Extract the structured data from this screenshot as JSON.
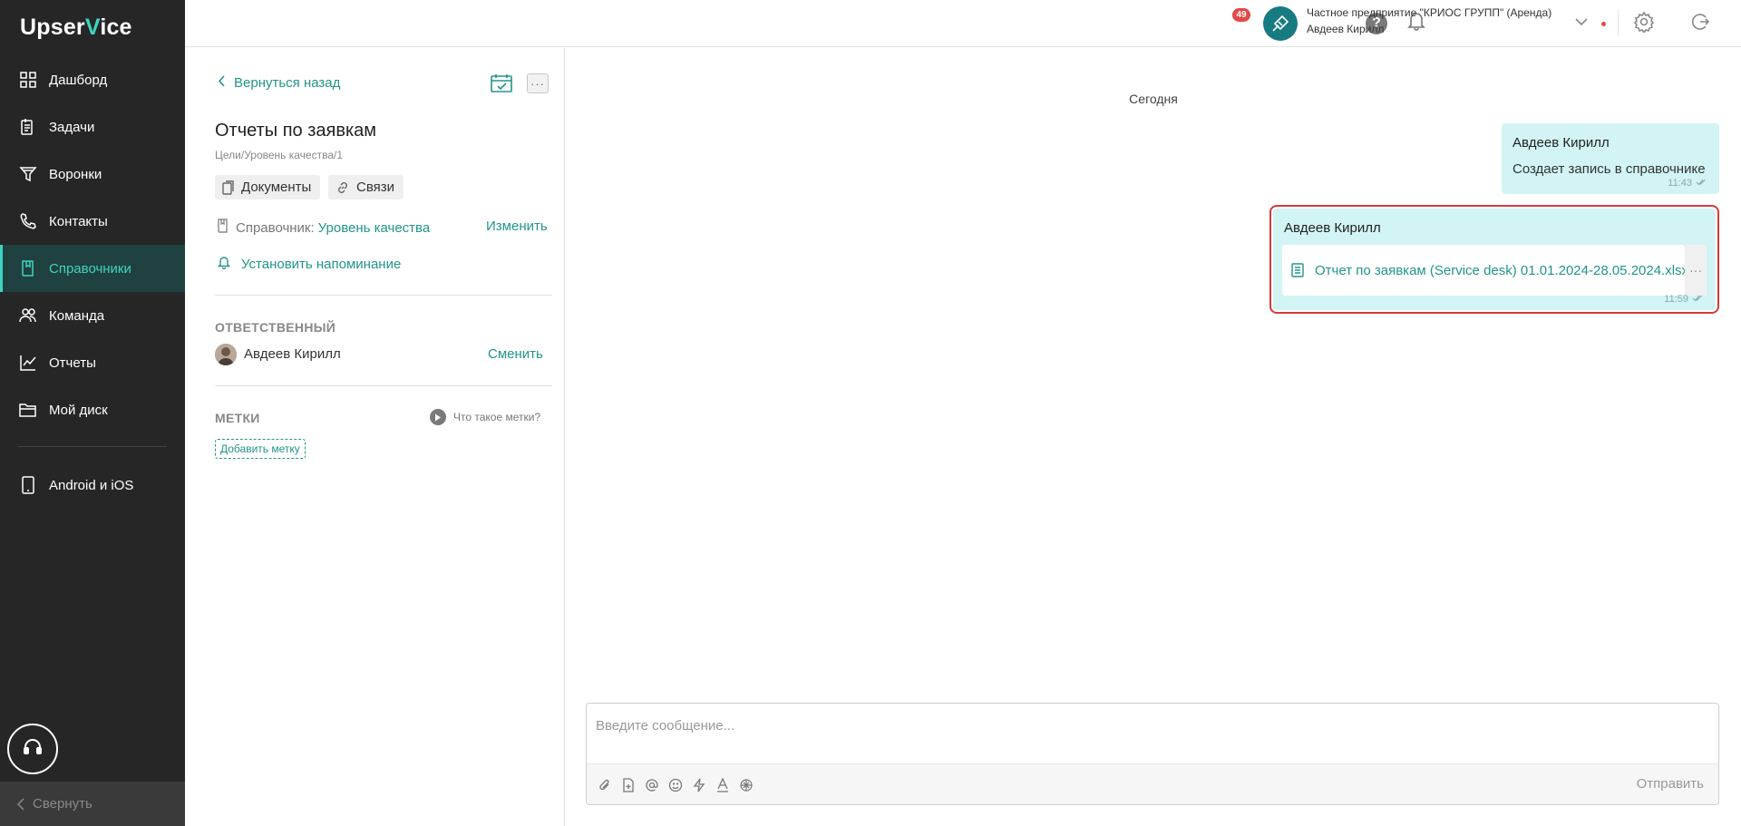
{
  "app": {
    "logo_prefix": "Upser",
    "logo_v": "V",
    "logo_suffix": "ice"
  },
  "sidebar": {
    "items": [
      {
        "label": "Дашборд",
        "icon": "dashboard-icon"
      },
      {
        "label": "Задачи",
        "icon": "tasks-icon"
      },
      {
        "label": "Воронки",
        "icon": "funnel-icon"
      },
      {
        "label": "Контакты",
        "icon": "phone-icon"
      },
      {
        "label": "Справочники",
        "icon": "book-icon",
        "active": true
      },
      {
        "label": "Команда",
        "icon": "team-icon"
      },
      {
        "label": "Отчеты",
        "icon": "chart-icon"
      },
      {
        "label": "Мой диск",
        "icon": "folder-icon"
      }
    ],
    "mobile_label": "Android и iOS",
    "collapse_label": "Свернуть"
  },
  "header": {
    "help": "?",
    "notifications_count": "49",
    "org_name": "Частное предприятие \"КРИОС ГРУПП\" (Аренда)",
    "user_name": "Авдеев Кирилл"
  },
  "panel": {
    "back_label": "Вернуться назад",
    "more_label": "···",
    "title": "Отчеты по заявкам",
    "path": "Цели/Уровень качества/1",
    "documents_label": "Документы",
    "links_label": "Связи",
    "reference_label": "Справочник:",
    "reference_value": "Уровень качества",
    "edit_label": "Изменить",
    "reminder_label": "Установить напоминание",
    "responsible_header": "ОТВЕТСТВЕННЫЙ",
    "responsible_name": "Авдеев Кирилл",
    "change_label": "Сменить",
    "tags_header": "МЕТКИ",
    "what_tags_label": "Что такое метки?",
    "add_tag_label": "Добавить метку"
  },
  "chat": {
    "day_label": "Сегодня",
    "messages": [
      {
        "author": "Авдеев Кирилл",
        "text": "Создает запись в справочнике",
        "time": "11:43"
      },
      {
        "author": "Авдеев Кирилл",
        "file": "Отчет по заявкам (Service desk) 01.01.2024-28.05.2024.xlsx",
        "more": "···",
        "time": "11:59"
      }
    ],
    "input_placeholder": "Введите сообщение...",
    "send_label": "Отправить"
  },
  "colors": {
    "accent": "#22958a",
    "sidebar_bg": "#262626",
    "bubble_bg": "#d2f4f4",
    "highlight": "#d63a3a"
  }
}
